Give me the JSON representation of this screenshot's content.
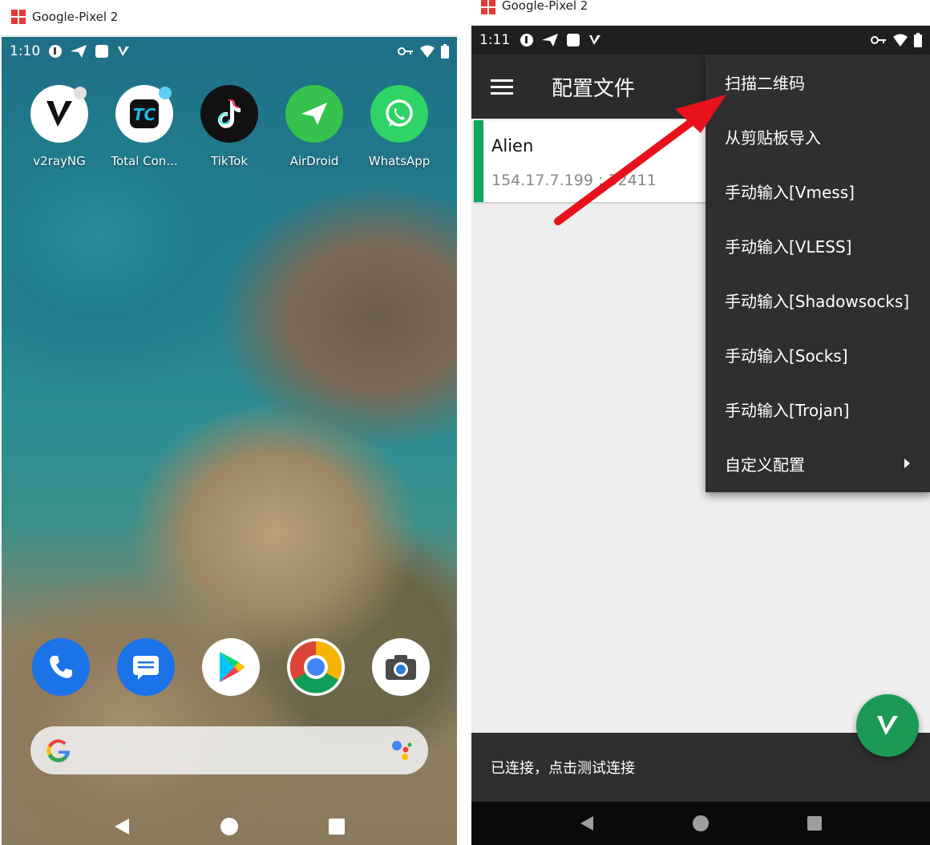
{
  "left": {
    "window_title": "Google-Pixel 2",
    "status_time": "1:10",
    "apps": [
      {
        "label": "v2rayNG",
        "icon": "v2rayng-icon"
      },
      {
        "label": "Total Con...",
        "icon": "total-commander-icon"
      },
      {
        "label": "TikTok",
        "icon": "tiktok-icon"
      },
      {
        "label": "AirDroid",
        "icon": "airdroid-icon"
      },
      {
        "label": "WhatsApp",
        "icon": "whatsapp-icon"
      }
    ],
    "dock": [
      "phone-icon",
      "messages-icon",
      "play-store-icon",
      "chrome-icon",
      "camera-icon"
    ]
  },
  "right": {
    "window_title": "Google-Pixel 2",
    "status_time": "1:11",
    "app_title": "配置文件",
    "server": {
      "name": "Alien",
      "address": "154.17.7.199 : 32411"
    },
    "menu": [
      "扫描二维码",
      "从剪贴板导入",
      "手动输入[Vmess]",
      "手动输入[VLESS]",
      "手动输入[Shadowsocks]",
      "手动输入[Socks]",
      "手动输入[Trojan]",
      "自定义配置"
    ],
    "status_message": "已连接，点击测试连接"
  },
  "colors": {
    "accent_green": "#10a45d",
    "arrow_red": "#e8121c",
    "dark_bar": "#2b2b2b"
  }
}
